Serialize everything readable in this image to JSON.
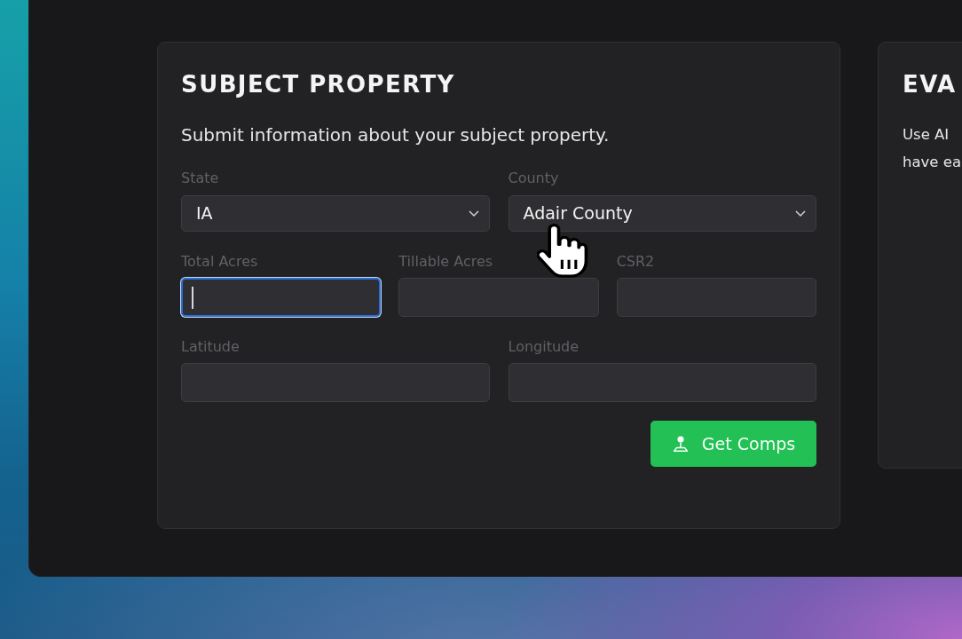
{
  "subject_property": {
    "title": "SUBJECT PROPERTY",
    "description": "Submit information about your subject property.",
    "field_rows": [
      [
        {
          "kind": "select",
          "label": "State",
          "value": "IA",
          "focused": false
        },
        {
          "kind": "select",
          "label": "County",
          "value": "Adair County",
          "focused": false
        }
      ],
      [
        {
          "kind": "text",
          "label": "Total Acres",
          "focused": true
        },
        {
          "kind": "text",
          "label": "Tillable Acres",
          "focused": false
        },
        {
          "kind": "text",
          "label": "CSR2",
          "focused": false
        }
      ],
      [
        {
          "kind": "text",
          "label": "Latitude",
          "focused": false
        },
        {
          "kind": "text",
          "label": "Longitude",
          "focused": false
        }
      ]
    ],
    "submit_button": {
      "label": "Get Comps"
    }
  },
  "evaluation_panel": {
    "title": "EVA",
    "description_lines": [
      "Use AI",
      "have ea"
    ]
  }
}
